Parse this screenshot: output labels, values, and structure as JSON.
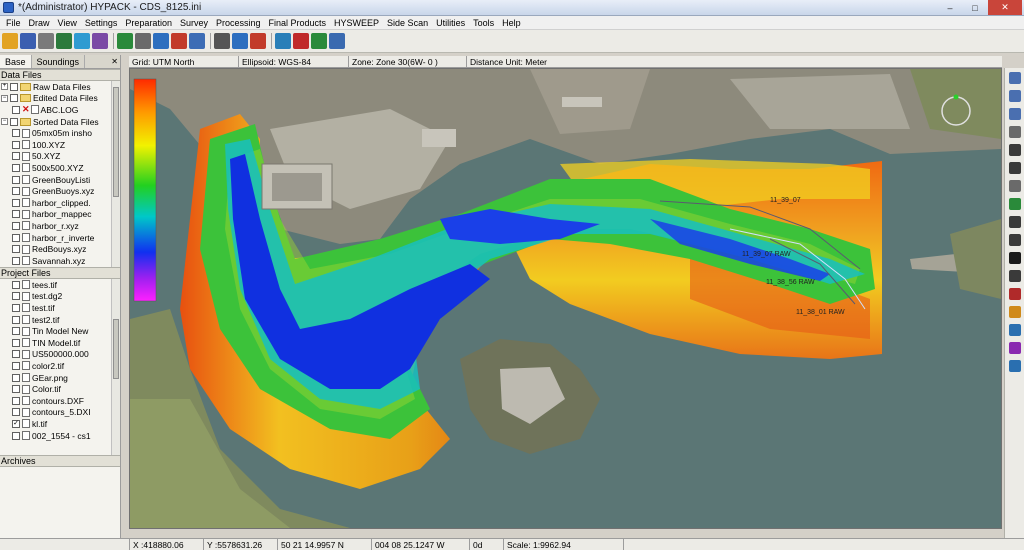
{
  "window": {
    "title": "*(Administrator) HYPACK - CDS_8125.ini",
    "controls": {
      "minimize": "–",
      "maximize": "□",
      "close": "✕"
    }
  },
  "menu": [
    "File",
    "Draw",
    "View",
    "Settings",
    "Preparation",
    "Survey",
    "Processing",
    "Final Products",
    "HYSWEEP",
    "Side Scan",
    "Utilities",
    "Tools",
    "Help"
  ],
  "toolbar": {
    "icons": [
      "open-folder-icon",
      "save-icon",
      "print-icon",
      "chart-icon",
      "color-map-icon",
      "edit-line-icon",
      "globe-icon",
      "keyboard-icon",
      "boat-icon",
      "view-3d-icon",
      "grid-icon",
      "cursor-icon",
      "settings-icon",
      "text-icon",
      "profile-icon",
      "triangle-icon",
      "arrow-icon",
      "checklist-icon"
    ],
    "colors": [
      "#e2a322",
      "#3b5fb0",
      "#7a7a7a",
      "#2c7a3c",
      "#2f9bd1",
      "#7b4aa5",
      "#2a8a3a",
      "#6a6a6a",
      "#2d6fbf",
      "#c23b2a",
      "#3d6db5",
      "#555555",
      "#2d6fbf",
      "#c23b2a",
      "#2a7fb8",
      "#c02a2a",
      "#2a8a3a",
      "#3a6ab0"
    ]
  },
  "left_panel": {
    "tabs": [
      "Base",
      "Soundings"
    ],
    "data_files_header": "Data Files",
    "data_files": [
      {
        "label": "Raw Data Files",
        "type": "folder",
        "level": 0,
        "expander": "+"
      },
      {
        "label": "Edited Data Files",
        "type": "folder",
        "level": 0,
        "expander": "−"
      },
      {
        "label": "ABC.LOG",
        "type": "file",
        "level": 1,
        "excluded": true
      },
      {
        "label": "Sorted Data Files",
        "type": "folder",
        "level": 0,
        "expander": "−"
      },
      {
        "label": "05mx05m insho",
        "type": "file",
        "level": 1
      },
      {
        "label": "100.XYZ",
        "type": "file",
        "level": 1
      },
      {
        "label": "50.XYZ",
        "type": "file",
        "level": 1
      },
      {
        "label": "500x500.XYZ",
        "type": "file",
        "level": 1
      },
      {
        "label": "GreenBouyListi",
        "type": "file",
        "level": 1
      },
      {
        "label": "GreenBuoys.xyz",
        "type": "file",
        "level": 1
      },
      {
        "label": "harbor_clipped.",
        "type": "file",
        "level": 1
      },
      {
        "label": "harbor_mappec",
        "type": "file",
        "level": 1
      },
      {
        "label": "harbor_r.xyz",
        "type": "file",
        "level": 1
      },
      {
        "label": "harbor_r_inverte",
        "type": "file",
        "level": 1
      },
      {
        "label": "RedBouys.xyz",
        "type": "file",
        "level": 1
      },
      {
        "label": "Savannah.xyz",
        "type": "file",
        "level": 1
      }
    ],
    "project_files_header": "Project Files",
    "project_files": [
      {
        "label": "tees.tif",
        "checked": false
      },
      {
        "label": "test.dg2",
        "checked": false
      },
      {
        "label": "test.tif",
        "checked": false
      },
      {
        "label": "test2.tif",
        "checked": false
      },
      {
        "label": "Tin Model New",
        "checked": false
      },
      {
        "label": "TIN Model.tif",
        "checked": false
      },
      {
        "label": "US500000.000",
        "checked": false
      },
      {
        "label": "color2.tif",
        "checked": false
      },
      {
        "label": "GEar.png",
        "checked": false
      },
      {
        "label": "Color.tif",
        "checked": false
      },
      {
        "label": "contours.DXF",
        "checked": false
      },
      {
        "label": "contours_5.DXI",
        "checked": false
      },
      {
        "label": "kl.tif",
        "checked": true
      },
      {
        "label": "002_1554 - cs1",
        "checked": false
      }
    ],
    "archives_header": "Archives"
  },
  "infobar": {
    "grid": "Grid: UTM North",
    "ellipsoid": "Ellipsoid: WGS-84",
    "zone": "Zone: Zone 30(6W- 0 )",
    "distance_unit": "Distance Unit: Meter"
  },
  "map": {
    "line_labels": [
      "11_39_07",
      "11_39_07 RAW",
      "11_38_56 RAW",
      "11_38_01 RAW"
    ],
    "colors": {
      "water": "#5d7877",
      "land": "#7f8a5e",
      "urban": "#9d9a8f",
      "deep": "#0a10d0",
      "shallow": "#e65a10"
    }
  },
  "right_tools": {
    "icons": [
      "zoom-icon",
      "zoom-window-icon",
      "zoom-extents-icon",
      "pan-icon",
      "select-icon",
      "select-line-icon",
      "measure-icon",
      "node-icon",
      "rotate-icon",
      "move-icon",
      "north-arrow-icon",
      "edit-icon",
      "color-icon",
      "pencil-icon",
      "layers-icon",
      "wand-icon",
      "info-icon"
    ],
    "colors": [
      "#4a6fb0",
      "#4a6fb0",
      "#4a6fb0",
      "#6a6a6a",
      "#3a3a3a",
      "#3a3a3a",
      "#6a6a6a",
      "#2a8a3a",
      "#3a3a3a",
      "#3a3a3a",
      "#1a1a1a",
      "#3a3a3a",
      "#b02a2a",
      "#d08a1a",
      "#2a6fb0",
      "#8a2ab0",
      "#2a6fb0"
    ]
  },
  "statusbar": {
    "x": "X :418880.06",
    "y": "Y :5578631.26",
    "lat": "50 21 14.9957 N",
    "lon": "004 08 25.1247 W",
    "depth": "0d",
    "scale": "Scale: 1:9962.94"
  }
}
